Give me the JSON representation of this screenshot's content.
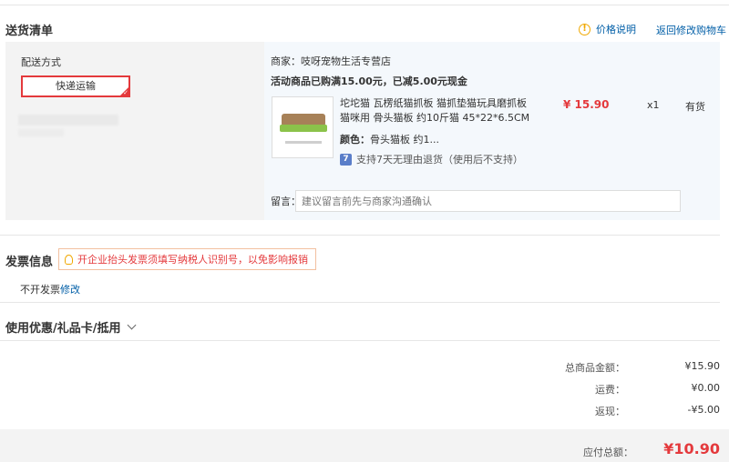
{
  "header": {
    "title": "送货清单",
    "price_help": "价格说明",
    "back_to_cart": "返回修改购物车"
  },
  "shipping": {
    "label": "配送方式",
    "method": "快递运输"
  },
  "order": {
    "seller": "商家：吱呀宠物生活专营店",
    "promotion": "活动商品已购满15.00元，已减5.00元现金",
    "product": {
      "name": "坨坨猫 瓦楞纸猫抓板 猫抓垫猫玩具磨抓板猫咪用 骨头猫板 约10斤猫 45*22*6.5CM",
      "color_label": "颜色：",
      "color_value": "骨头猫板 约1...",
      "returns": "支持7天无理由退货（使用后不支持）",
      "returns_badge": "7",
      "price": "¥ 15.90",
      "quantity": "x1",
      "stock": "有货"
    },
    "message_label": "留言：",
    "message_placeholder": "建议留言前先与商家沟通确认"
  },
  "invoice": {
    "title": "发票信息",
    "tip": "开企业抬头发票须填写纳税人识别号，以免影响报销",
    "value": "不开发票",
    "edit": "修改"
  },
  "coupon": {
    "label": "使用优惠/礼品卡/抵用"
  },
  "summary": {
    "goods_label": "总商品金额：",
    "goods_value": "¥15.90",
    "shipping_label": "运费：",
    "shipping_value": "¥0.00",
    "cashback_label": "返现：",
    "cashback_value": "-¥5.00",
    "total_label": "应付总额：",
    "total_value": "¥10.90"
  },
  "colors": {
    "accent_red": "#e4393c",
    "link_blue": "#005ea7",
    "warning_orange": "#f0a800"
  }
}
